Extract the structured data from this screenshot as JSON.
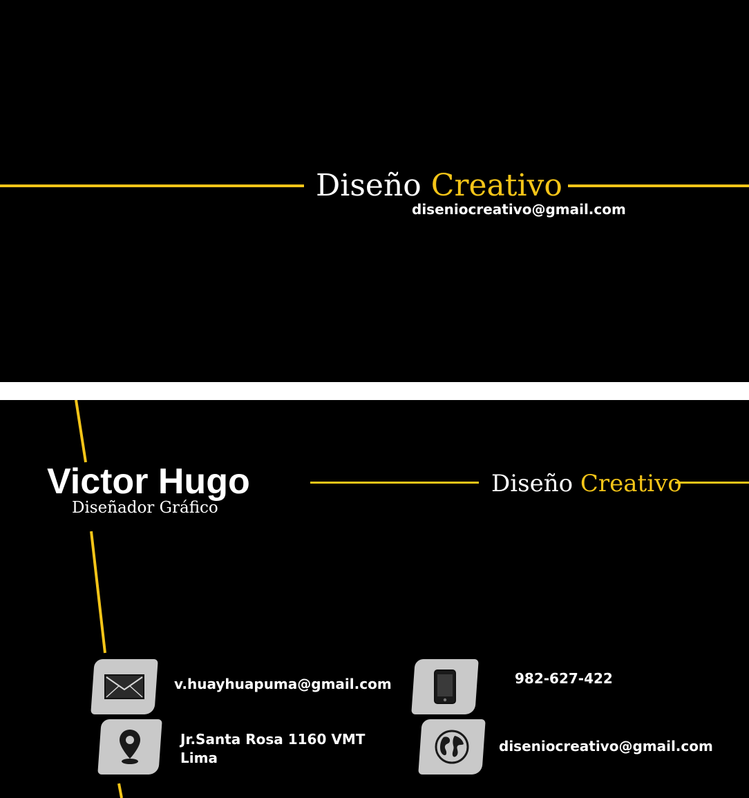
{
  "front": {
    "brand_word1": "Diseño",
    "brand_word2": "Creativo",
    "email": "diseniocreativo@gmail.com"
  },
  "back": {
    "name": "Victor Hugo",
    "role": "Diseñador Gráfico",
    "brand_word1": "Diseño",
    "brand_word2": "Creativo",
    "contacts": {
      "email": "v.huayhuapuma@gmail.com",
      "phone": "982-627-422",
      "address_line1": "Jr.Santa Rosa 1160 VMT",
      "address_line2": "Lima",
      "web": "diseniocreativo@gmail.com"
    },
    "icons": [
      "mail-icon",
      "phone-icon",
      "location-pin-icon",
      "globe-icon"
    ]
  },
  "colors": {
    "accent": "#f5c518",
    "background": "#000000",
    "tile": "#c9c9c9",
    "text": "#ffffff"
  }
}
